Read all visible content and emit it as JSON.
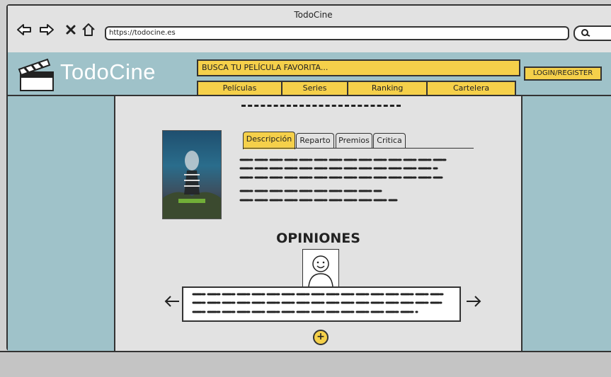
{
  "window": {
    "title": "TodoCine"
  },
  "browser": {
    "url": "https://todocine.es"
  },
  "site": {
    "logo_text": "TodoCine",
    "search_placeholder": "BUSCA TU PELÍCULA FAVORITA...",
    "login_label": "LOGIN/REGISTER",
    "nav": [
      "Películas",
      "Series",
      "Ranking",
      "Cartelera"
    ]
  },
  "movie": {
    "tabs": [
      "Descripción",
      "Reparto",
      "Premios",
      "Critica"
    ],
    "active_tab": "Descripción"
  },
  "reviews": {
    "heading": "OPINIONES",
    "add_label": "+"
  },
  "colors": {
    "accent": "#f5d04a",
    "header_bg": "#9fc2c9",
    "page_bg": "#e2e2e2"
  }
}
